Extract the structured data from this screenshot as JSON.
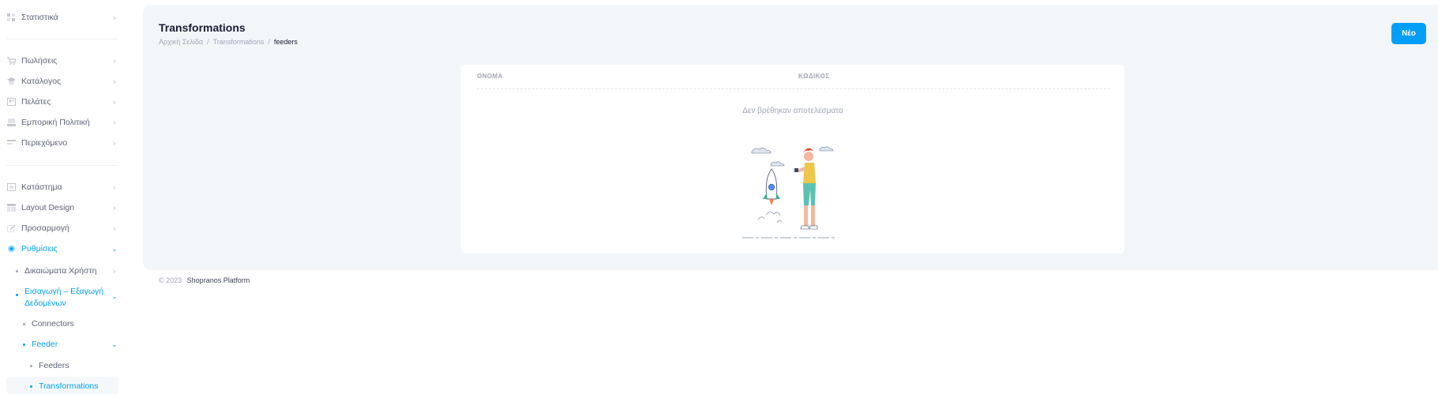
{
  "sidebar": {
    "items": [
      {
        "label": "Στατιστικά",
        "icon": "chart-icon"
      },
      {
        "label": "Πωλήσεις",
        "icon": "cart-icon"
      },
      {
        "label": "Κατάλογος",
        "icon": "catalog-icon"
      },
      {
        "label": "Πελάτες",
        "icon": "customers-icon"
      },
      {
        "label": "Εμπορική Πολιτική",
        "icon": "policy-icon"
      },
      {
        "label": "Περιεχόμενο",
        "icon": "content-icon"
      },
      {
        "label": "Κατάστημα",
        "icon": "store-icon"
      },
      {
        "label": "Layout Design",
        "icon": "layout-icon"
      },
      {
        "label": "Προσαρμογή",
        "icon": "edit-icon"
      },
      {
        "label": "Ρυθμίσεις",
        "icon": "settings-icon"
      }
    ],
    "sub": {
      "user_rights": "Δικαιώματα Χρήστη",
      "import_export": "Εισαγωγή – Εξαγωγή Δεδομένων",
      "connectors": "Connectors",
      "feeder": "Feeder",
      "feeders": "Feeders",
      "transformations": "Transformations"
    }
  },
  "header": {
    "title": "Transformations",
    "breadcrumbs": [
      "Αρχική Σελίδα",
      "Transformations",
      "feeders"
    ],
    "new_button": "Νέο"
  },
  "table": {
    "columns": [
      "ΟΝΟΜΑ",
      "ΚΩΔΙΚΟΣ"
    ],
    "empty_text": "Δεν βρέθηκαν αποτελέσματα"
  },
  "footer": {
    "copyright": "© 2023",
    "brand": "Shopranos Platform"
  },
  "colors": {
    "accent": "#009ef7",
    "main_bg": "#f3f6f9"
  }
}
